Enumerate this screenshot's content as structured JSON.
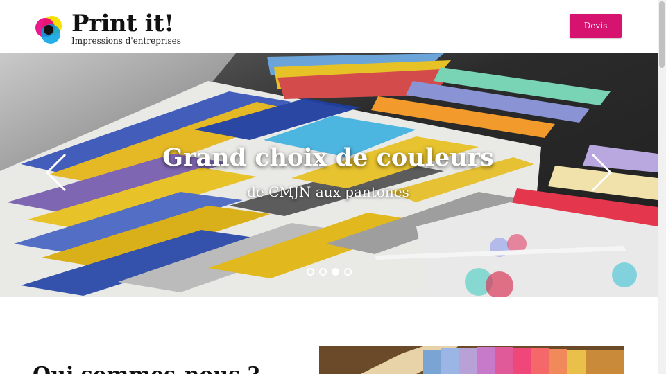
{
  "header": {
    "logo_title": "Print it!",
    "logo_tagline": "Impressions d'entreprises",
    "devis_label": "Devis"
  },
  "hero": {
    "title": "Grand choix de couleurs",
    "subtitle": "de CMJN aux pantones",
    "slide_count": 4,
    "active_slide": 3
  },
  "section": {
    "title": "Qui sommes-nous ?"
  },
  "colors": {
    "accent": "#d6136f",
    "text": "#111111"
  },
  "icons": {
    "prev": "chevron-left-icon",
    "next": "chevron-right-icon"
  }
}
